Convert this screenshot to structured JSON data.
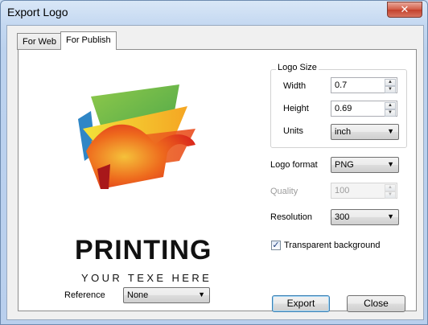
{
  "window": {
    "title": "Export Logo",
    "close_label": "✕"
  },
  "tabs": [
    {
      "label": "For Web",
      "active": false
    },
    {
      "label": "For Publish",
      "active": true
    }
  ],
  "preview": {
    "brand": "PRINTING",
    "tagline": "YOUR TEXE HERE"
  },
  "reference": {
    "label": "Reference",
    "value": "None"
  },
  "logo_size": {
    "title": "Logo Size",
    "width_label": "Width",
    "width_value": "0.7",
    "height_label": "Height",
    "height_value": "0.69",
    "units_label": "Units",
    "units_value": "inch"
  },
  "logo_format": {
    "label": "Logo format",
    "value": "PNG"
  },
  "quality": {
    "label": "Quality",
    "value": "100"
  },
  "resolution": {
    "label": "Resolution",
    "value": "300"
  },
  "transparent": {
    "label": "Transparent background",
    "checked": true
  },
  "buttons": {
    "export": "Export",
    "close": "Close"
  },
  "colors": {
    "accent": "#3c7fb1",
    "title_bar": "#c4d8f1"
  }
}
